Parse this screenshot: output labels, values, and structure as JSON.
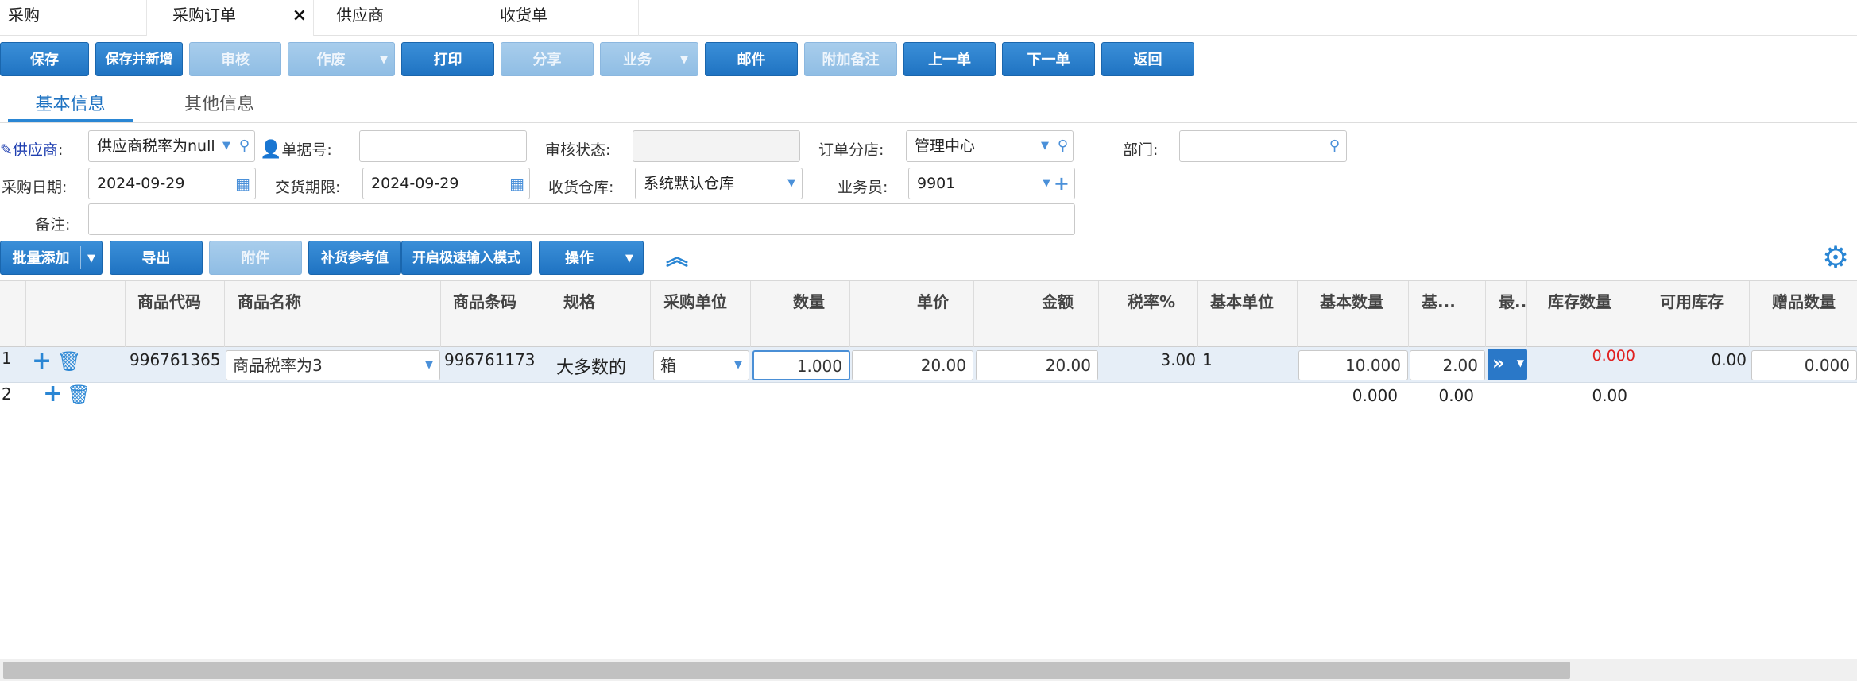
{
  "tabs": [
    {
      "label": "采购"
    },
    {
      "label": "采购订单",
      "close": "×"
    },
    {
      "label": "供应商"
    },
    {
      "label": "收货单"
    }
  ],
  "toolbar": {
    "save": "保存",
    "save_new": "保存并新增",
    "review": "审核",
    "void": "作废",
    "print": "打印",
    "share": "分享",
    "business": "业务",
    "mail": "邮件",
    "remark": "附加备注",
    "prev": "上一单",
    "next": "下一单",
    "back": "返回"
  },
  "subtabs": {
    "basic": "基本信息",
    "other": "其他信息"
  },
  "form": {
    "supplier_label": "供应商",
    "supplier_value": "供应商税率为null",
    "bill_no_label": "单据号:",
    "bill_no_value": "",
    "review_status_label": "审核状态:",
    "review_status_value": "",
    "branch_label": "订单分店:",
    "branch_value": "管理中心",
    "dept_label": "部门:",
    "dept_value": "",
    "purchase_date_label": "采购日期:",
    "purchase_date_value": "2024-09-29",
    "delivery_label": "交货期限:",
    "delivery_value": "2024-09-29",
    "warehouse_label": "收货仓库:",
    "warehouse_value": "系统默认仓库",
    "salesman_label": "业务员:",
    "salesman_value": "9901",
    "note_label": "备注:",
    "note_value": ""
  },
  "grid_toolbar": {
    "batch_add": "批量添加",
    "export": "导出",
    "attach": "附件",
    "restock": "补货参考值",
    "fast_input": "开启极速输入模式",
    "ops": "操作"
  },
  "columns": {
    "code": "商品代码",
    "name": "商品名称",
    "barcode": "商品条码",
    "spec": "规格",
    "unit": "采购单位",
    "qty": "数量",
    "price": "单价",
    "amount": "金额",
    "tax": "税率%",
    "base_unit": "基本单位",
    "base_qty": "基本数量",
    "base_trunc": "基...",
    "max_trunc": "最..",
    "stock": "库存数量",
    "avail": "可用库存",
    "gift": "赠品数量"
  },
  "rows": [
    {
      "no": "1",
      "code": "996761365",
      "name": "商品税率为3",
      "barcode": "996761173",
      "spec": "大多数的",
      "unit": "箱",
      "qty": "1.000",
      "price": "20.00",
      "amount": "20.00",
      "tax": "3.00",
      "base_unit": "1",
      "base_qty": "10.000",
      "base2": "2.00",
      "stock": "0.000",
      "avail": "0.00",
      "gift": "0.000"
    },
    {
      "no": "2",
      "base_qty": "0.000",
      "base2": "0.00",
      "stock": "0.00"
    }
  ],
  "colors": {
    "primary": "#1f73c2",
    "disabled": "#9ec7ea",
    "row_selected": "#e6eef7",
    "negative": "#e02020"
  }
}
